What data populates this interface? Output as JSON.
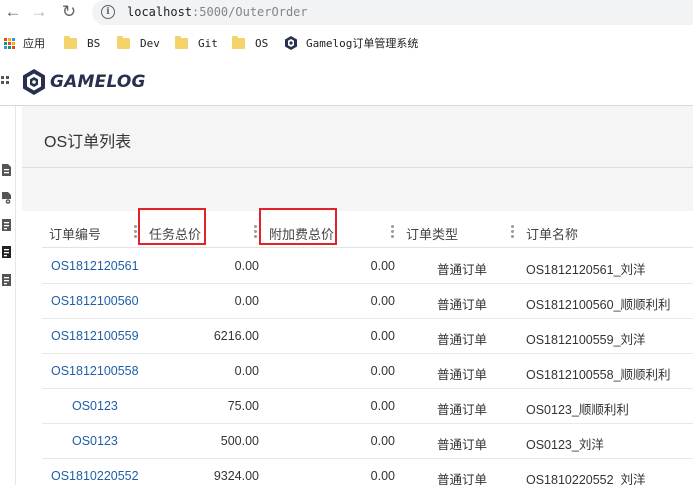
{
  "browser": {
    "url_host": "localhost",
    "url_path": ":5000/OuterOrder",
    "bookmarks": [
      {
        "label": "应用",
        "icon": "apps-grid-icon"
      },
      {
        "label": "BS",
        "icon": "folder-icon"
      },
      {
        "label": "Dev",
        "icon": "folder-icon"
      },
      {
        "label": "Git",
        "icon": "folder-icon"
      },
      {
        "label": "OS",
        "icon": "folder-icon"
      },
      {
        "label": "Gamelog订单管理系统",
        "icon": "gamelog-favicon"
      }
    ]
  },
  "app": {
    "logo_text": "GAMELOG",
    "brand_color": "#27304f"
  },
  "page": {
    "title": "OS订单列表"
  },
  "table": {
    "columns": [
      "订单编号",
      "任务总价",
      "附加费总价",
      "订单类型",
      "订单名称"
    ],
    "highlighted_columns": [
      "任务总价",
      "附加费总价"
    ],
    "rows": [
      {
        "id": "OS1812120561",
        "task_total": "0.00",
        "extra_total": "0.00",
        "type": "普通订单",
        "name": "OS1812120561_刘洋",
        "child": false
      },
      {
        "id": "OS1812100560",
        "task_total": "0.00",
        "extra_total": "0.00",
        "type": "普通订单",
        "name": "OS1812100560_顺顺利利",
        "child": false
      },
      {
        "id": "OS1812100559",
        "task_total": "6216.00",
        "extra_total": "0.00",
        "type": "普通订单",
        "name": "OS1812100559_刘洋",
        "child": false
      },
      {
        "id": "OS1812100558",
        "task_total": "0.00",
        "extra_total": "0.00",
        "type": "普通订单",
        "name": "OS1812100558_顺顺利利",
        "child": false
      },
      {
        "id": "OS0123",
        "task_total": "75.00",
        "extra_total": "0.00",
        "type": "普通订单",
        "name": "OS0123_顺顺利利",
        "child": true
      },
      {
        "id": "OS0123",
        "task_total": "500.00",
        "extra_total": "0.00",
        "type": "普通订单",
        "name": "OS0123_刘洋",
        "child": true
      },
      {
        "id": "OS1810220552",
        "task_total": "9324.00",
        "extra_total": "0.00",
        "type": "普通订单",
        "name": "OS1810220552_刘洋",
        "child": false
      }
    ]
  },
  "colors": {
    "link": "#1f5fa8",
    "highlight": "#e1232a",
    "panel_bg": "#f5f5f5"
  }
}
